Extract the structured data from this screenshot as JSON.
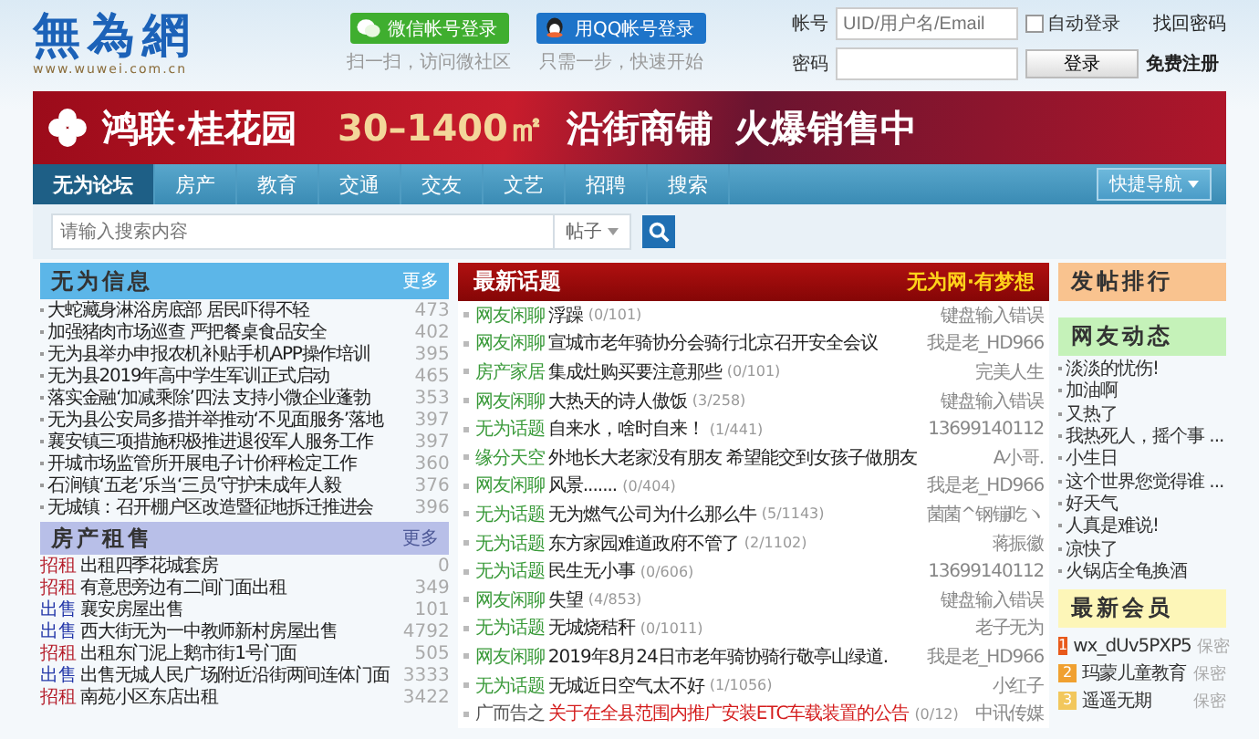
{
  "logo": {
    "text": "無為網",
    "url": "www.wuwei.com.cn"
  },
  "social_login": [
    {
      "kind": "wechat",
      "label": "微信帐号登录",
      "caption": "扫一扫，访问微社区"
    },
    {
      "kind": "qq",
      "label": "用QQ帐号登录",
      "caption": "只需一步，快速开始"
    }
  ],
  "login": {
    "account_label": "帐号",
    "account_placeholder": "UID/用户名/Email",
    "auto_login": {
      "label": "自动登录",
      "checked": false
    },
    "forgot": "找回密码",
    "password_label": "密码",
    "submit": "登录",
    "register": "免费注册"
  },
  "banner": {
    "brand": "鸿联·桂花园",
    "area": "30–1400㎡",
    "text1": "沿街商铺",
    "text2": "火爆销售中"
  },
  "nav": {
    "tabs": [
      {
        "label": "无为论坛",
        "selected": true
      },
      {
        "label": "房产",
        "selected": false
      },
      {
        "label": "教育",
        "selected": false
      },
      {
        "label": "交通",
        "selected": false
      },
      {
        "label": "交友",
        "selected": false
      },
      {
        "label": "文艺",
        "selected": false
      },
      {
        "label": "招聘",
        "selected": false
      },
      {
        "label": "搜索",
        "selected": false
      }
    ],
    "quick_nav": "快捷导航"
  },
  "search": {
    "placeholder": "请输入搜索内容",
    "scope": "帖子"
  },
  "info": {
    "title": "无为信息",
    "more": "更多",
    "items": [
      {
        "title": "大蛇藏身淋浴房底部 居民吓得不轻",
        "count": "473"
      },
      {
        "title": "加强猪肉市场巡查 严把餐桌食品安全",
        "count": "402"
      },
      {
        "title": "无为县举办申报农机补贴手机APP操作培训",
        "count": "395"
      },
      {
        "title": "无为县2019年高中学生军训正式启动",
        "count": "465"
      },
      {
        "title": "落实金融‘加减乘除’四法 支持小微企业蓬勃",
        "count": "353"
      },
      {
        "title": "无为县公安局多措并举推动‘不见面服务’落地",
        "count": "397"
      },
      {
        "title": "襄安镇三项措施积极推进退役军人服务工作",
        "count": "397"
      },
      {
        "title": "开城市场监管所开展电子计价秤检定工作",
        "count": "360"
      },
      {
        "title": "石涧镇‘五老’乐当‘三员’守护未成年人毅",
        "count": "376"
      },
      {
        "title": "无城镇：召开棚户区改造暨征地拆迁推进会",
        "count": "396"
      }
    ]
  },
  "rental": {
    "title": "房产租售",
    "more": "更多",
    "items": [
      {
        "kind": "rent",
        "tag": "招租",
        "title": "出租四季花城套房",
        "count": "0"
      },
      {
        "kind": "rent",
        "tag": "招租",
        "title": "有意思旁边有二间门面出租",
        "count": "349"
      },
      {
        "kind": "sale",
        "tag": "出售",
        "title": "襄安房屋出售",
        "count": "101"
      },
      {
        "kind": "sale",
        "tag": "出售",
        "title": "西大街无为一中教师新村房屋出售",
        "count": "4792"
      },
      {
        "kind": "rent",
        "tag": "招租",
        "title": "出租东门泥上鹅市街1号门面",
        "count": "505"
      },
      {
        "kind": "sale",
        "tag": "出售",
        "title": "出售无城人民广场附近沿街两间连体门面",
        "count": "3333"
      },
      {
        "kind": "rent",
        "tag": "招租",
        "title": "南苑小区东店出租",
        "count": "3422"
      }
    ]
  },
  "topics": {
    "title": "最新话题",
    "slogan": "无为网·有梦想",
    "items": [
      {
        "kind": "normal",
        "category": "网友闲聊",
        "title": "浮躁",
        "stats": "(0/101)",
        "author": "键盘输入错误"
      },
      {
        "kind": "normal",
        "category": "网友闲聊",
        "title": "宣城市老年骑协分会骑行北京召开安全会议",
        "author": "我是老_HD966"
      },
      {
        "kind": "normal",
        "category": "房产家居",
        "title": "集成灶购买要注意那些",
        "stats": "(0/101)",
        "author": "完美人生"
      },
      {
        "kind": "normal",
        "category": "网友闲聊",
        "title": "大热天的诗人傲饭",
        "stats": "(3/258)",
        "author": "键盘输入错误"
      },
      {
        "kind": "normal",
        "category": "无为话题",
        "title": "自来水，啥时自来！",
        "stats": "(1/441)",
        "author": "13699140112"
      },
      {
        "kind": "normal",
        "category": "缘分天空",
        "title": "外地长大老家没有朋友 希望能交到女孩子做朋友",
        "author": "A小哥."
      },
      {
        "kind": "normal",
        "category": "网友闲聊",
        "title": "风景.......",
        "stats": "(0/404)",
        "author": "我是老_HD966"
      },
      {
        "kind": "normal",
        "category": "无为话题",
        "title": "无为燃气公司为什么那么牛",
        "stats": "(5/1143)",
        "author": "菌菌^钢镚吃ヽ"
      },
      {
        "kind": "normal",
        "category": "无为话题",
        "title": "东方家园难道政府不管了",
        "stats": "(2/1102)",
        "author": "蒋振徽"
      },
      {
        "kind": "normal",
        "category": "无为话题",
        "title": "民生无小事",
        "stats": "(0/606)",
        "author": "13699140112"
      },
      {
        "kind": "normal",
        "category": "网友闲聊",
        "title": "失望",
        "stats": "(4/853)",
        "author": "键盘输入错误"
      },
      {
        "kind": "normal",
        "category": "无为话题",
        "title": "无城烧秸秆",
        "stats": "(0/1011)",
        "author": "老子无为"
      },
      {
        "kind": "normal",
        "category": "网友闲聊",
        "title": "2019年8月24日市老年骑协骑行敬亭山绿道.",
        "author": "我是老_HD966"
      },
      {
        "kind": "normal",
        "category": "无为话题",
        "title": "无城近日空气太不好",
        "stats": "(1/1056)",
        "author": "小红子"
      },
      {
        "kind": "ad",
        "category": "广而告之",
        "title": "关于在全县范围内推广安装ETC车载装置的公告",
        "stats": "(0/12)",
        "author": "中讯传媒"
      }
    ]
  },
  "ranking": {
    "title": "发帖排行"
  },
  "activity": {
    "title": "网友动态",
    "items": [
      "淡淡的忧伤!",
      "加油啊",
      "又热了",
      "我热死人，摇个事 ...",
      "小生日",
      "这个世界您觉得谁 ...",
      "好天气",
      "人真是难说!",
      "凉快了",
      "火锅店全龟换酒"
    ]
  },
  "members": {
    "title": "最新会员",
    "items": [
      {
        "rank": "1",
        "color": "#e8591a",
        "name": "wx_dUv5PXP5",
        "privacy": "保密"
      },
      {
        "rank": "2",
        "color": "#f0a030",
        "name": "玛蒙儿童教育",
        "privacy": "保密"
      },
      {
        "rank": "3",
        "color": "#f2c75c",
        "name": "遥遥无期",
        "privacy": "保密"
      }
    ]
  }
}
